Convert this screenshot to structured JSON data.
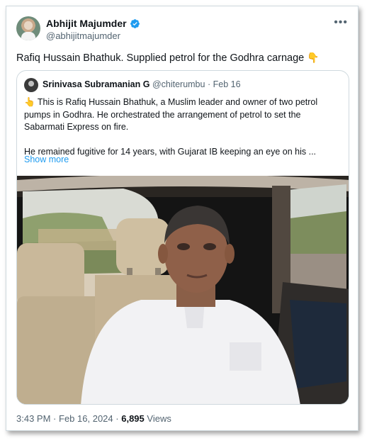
{
  "author": {
    "name": "Abhijit Majumder",
    "handle": "@abhijitmajumder"
  },
  "menu_icon": "ellipsis-icon",
  "tweet": {
    "text": "Rafiq Hussain Bhathuk. Supplied petrol for the Godhra carnage",
    "emoji": "👇"
  },
  "quote": {
    "name": "Srinivasa Subramanian G",
    "handle": "@chiterumbu",
    "separator": "·",
    "date": "Feb 16",
    "para1_emoji": "👆",
    "para1": "This is Rafiq Hussain Bhathuk, a Muslim leader and owner of two petrol pumps in Godhra. He orchestrated the arrangement of petrol to set the Sabarmati Express on fire.",
    "para2": "He remained fugitive for 14 years, with Gujarat IB keeping an eye on his ...",
    "show_more": "Show more"
  },
  "meta": {
    "time": "3:43 PM",
    "separator": "·",
    "date": "Feb 16, 2024",
    "views_count": "6,895",
    "views_label": "Views"
  },
  "colors": {
    "link": "#1d9bf0",
    "verified": "#1d9bf0",
    "secondary_text": "#536471"
  }
}
